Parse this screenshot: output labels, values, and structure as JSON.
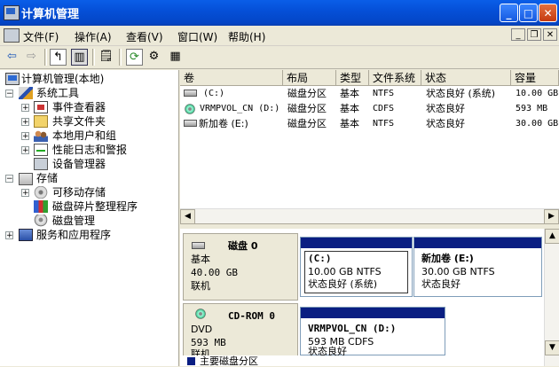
{
  "window": {
    "title": "计算机管理",
    "buttons": {
      "minimize": "_",
      "maximize": "□",
      "close": "✕"
    }
  },
  "menu": {
    "items": [
      "文件(F)",
      "操作(A)",
      "查看(V)",
      "窗口(W)",
      "帮助(H)"
    ]
  },
  "tree": {
    "items": [
      {
        "label": "计算机管理(本地)",
        "icon": "computer-icon",
        "expander": "−"
      },
      {
        "label": "系统工具",
        "icon": "tools-icon",
        "expander": "−"
      },
      {
        "label": "事件查看器",
        "icon": "event-viewer-icon",
        "expander": "+"
      },
      {
        "label": "共享文件夹",
        "icon": "shared-folder-icon",
        "expander": "+"
      },
      {
        "label": "本地用户和组",
        "icon": "users-icon",
        "expander": "+"
      },
      {
        "label": "性能日志和警报",
        "icon": "performance-icon",
        "expander": "+"
      },
      {
        "label": "设备管理器",
        "icon": "device-manager-icon",
        "expander": ""
      },
      {
        "label": "存储",
        "icon": "storage-icon",
        "expander": "−"
      },
      {
        "label": "可移动存储",
        "icon": "removable-storage-icon",
        "expander": "+"
      },
      {
        "label": "磁盘碎片整理程序",
        "icon": "defrag-icon",
        "expander": ""
      },
      {
        "label": "磁盘管理",
        "icon": "disk-management-icon",
        "expander": ""
      },
      {
        "label": "服务和应用程序",
        "icon": "services-icon",
        "expander": "+"
      }
    ]
  },
  "volumes": {
    "columns": [
      "卷",
      "布局",
      "类型",
      "文件系统",
      "状态",
      "容量"
    ],
    "rows": [
      {
        "volume": "(C:)",
        "layout": "磁盘分区",
        "type": "基本",
        "fs": "NTFS",
        "status": "状态良好 (系统)",
        "capacity": "10.00 GB"
      },
      {
        "volume": "VRMPVOL_CN (D:)",
        "layout": "磁盘分区",
        "type": "基本",
        "fs": "CDFS",
        "status": "状态良好",
        "capacity": "593 MB"
      },
      {
        "volume": "新加卷 (E:)",
        "layout": "磁盘分区",
        "type": "基本",
        "fs": "NTFS",
        "status": "状态良好",
        "capacity": "30.00 GB"
      }
    ]
  },
  "disks": [
    {
      "name": "磁盘 0",
      "kind": "基本",
      "size": "40.00 GB",
      "state": "联机",
      "partitions": [
        {
          "name": "(C:)",
          "info": "10.00 GB NTFS",
          "status": "状态良好 (系统)"
        },
        {
          "name": "新加卷  (E:)",
          "info": "30.00 GB NTFS",
          "status": "状态良好"
        }
      ]
    },
    {
      "name": "CD-ROM 0",
      "kind": "DVD",
      "size": "593 MB",
      "state": "联机",
      "partitions": [
        {
          "name": "VRMPVOL_CN   (D:)",
          "info": "593 MB CDFS",
          "status": "状态良好"
        }
      ]
    }
  ],
  "legend": {
    "label": "主要磁盘分区",
    "color": "#0a1e82"
  },
  "colors": {
    "title_bar": "#0550d8",
    "partition_bar": "#0a1e82"
  }
}
